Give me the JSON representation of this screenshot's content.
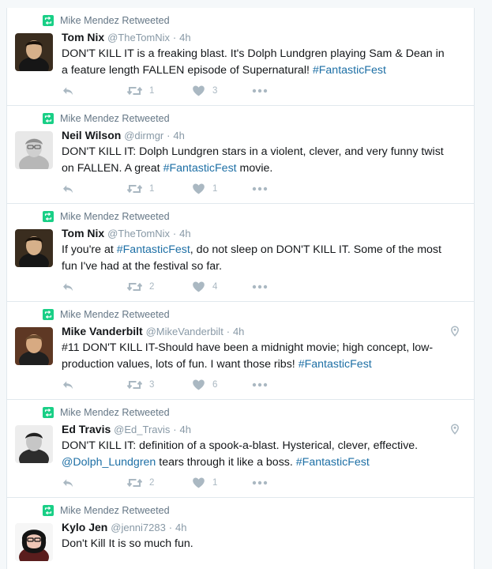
{
  "timeline": {
    "tweets": [
      {
        "retweeted_by": "Mike Mendez Retweeted",
        "name": "Tom Nix",
        "handle": "@TheTomNix",
        "time": "4h",
        "text_parts": [
          {
            "kind": "text",
            "value": "DON'T KILL IT is a freaking blast. It's Dolph Lundgren playing Sam & Dean in a feature length FALLEN episode of Supernatural! "
          },
          {
            "kind": "hashtag",
            "value": "#FantasticFest"
          }
        ],
        "retweets": "1",
        "likes": "3",
        "has_location": false
      },
      {
        "retweeted_by": "Mike Mendez Retweeted",
        "name": "Neil Wilson",
        "handle": "@dirmgr",
        "time": "4h",
        "text_parts": [
          {
            "kind": "text",
            "value": "DON'T KILL IT: Dolph Lundgren stars in a violent, clever, and very funny twist on FALLEN. A great "
          },
          {
            "kind": "hashtag",
            "value": "#FantasticFest"
          },
          {
            "kind": "text",
            "value": " movie."
          }
        ],
        "retweets": "1",
        "likes": "1",
        "has_location": false
      },
      {
        "retweeted_by": "Mike Mendez Retweeted",
        "name": "Tom Nix",
        "handle": "@TheTomNix",
        "time": "4h",
        "text_parts": [
          {
            "kind": "text",
            "value": "If you're at "
          },
          {
            "kind": "hashtag",
            "value": "#FantasticFest"
          },
          {
            "kind": "text",
            "value": ", do not sleep on DON'T KILL IT. Some of the most fun I've had at the festival so far."
          }
        ],
        "retweets": "2",
        "likes": "4",
        "has_location": false
      },
      {
        "retweeted_by": "Mike Mendez Retweeted",
        "name": "Mike Vanderbilt",
        "handle": "@MikeVanderbilt",
        "time": "4h",
        "text_parts": [
          {
            "kind": "text",
            "value": "#11 DON'T KILL IT-Should have been a midnight movie; high concept, low-production values, lots of fun. I want those ribs! "
          },
          {
            "kind": "hashtag",
            "value": "#FantasticFest"
          }
        ],
        "retweets": "3",
        "likes": "6",
        "has_location": true
      },
      {
        "retweeted_by": "Mike Mendez Retweeted",
        "name": "Ed Travis",
        "handle": "@Ed_Travis",
        "time": "4h",
        "text_parts": [
          {
            "kind": "text",
            "value": "DON'T KILL IT: definition of a spook-a-blast. Hysterical, clever, effective. "
          },
          {
            "kind": "mention",
            "value": "@Dolph_Lundgren"
          },
          {
            "kind": "text",
            "value": " tears through it like a boss. "
          },
          {
            "kind": "hashtag",
            "value": "#FantasticFest"
          }
        ],
        "retweets": "2",
        "likes": "1",
        "has_location": true
      },
      {
        "retweeted_by": "Mike Mendez Retweeted",
        "name": "Kylo Jen",
        "handle": "@jenni7283",
        "time": "4h",
        "text_parts": [
          {
            "kind": "text",
            "value": "Don't Kill It is so much fun."
          }
        ],
        "retweets": "",
        "likes": "",
        "has_location": false
      }
    ]
  },
  "ui": {
    "dot": "·",
    "colors": {
      "retweet_green": "#19cf86",
      "hashtag_blue": "#1d6fa5",
      "muted": "#8899a6",
      "action_gray": "#aab8c2"
    },
    "icons": {
      "retweet_badge": "retweet-icon",
      "reply": "reply-icon",
      "retweet_action": "retweet-icon",
      "like": "heart-icon",
      "more": "more-icon",
      "location": "location-pin-icon"
    }
  }
}
